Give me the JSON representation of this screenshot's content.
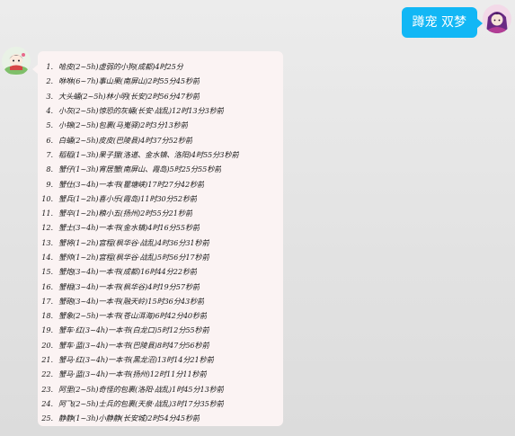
{
  "outgoing": {
    "sender_name": "蹲宠 双梦"
  },
  "incoming": {
    "items": [
      {
        "num": "1.",
        "text": "哈皮(2~5h)虚弱的小狗(成都)4时25分"
      },
      {
        "num": "2.",
        "text": "咻咻(6~7h)事山果(南屏山)2时55分45秒前"
      },
      {
        "num": "3.",
        "text": "大头蛹(2~5h)林小明(长安)2时56分47秒前"
      },
      {
        "num": "4.",
        "text": "小灰(2~5h)惊恐的灰蛹(长安·战乱)12时13分3秒前"
      },
      {
        "num": "5.",
        "text": "小锦(2~5h)包裹(马嵬驿)2时3分13秒前"
      },
      {
        "num": "6.",
        "text": "白蛹(2~5h)皮皮(巴陵县)4时37分52秒前"
      },
      {
        "num": "7.",
        "text": "稻稻(1~3h)果子狸(洛道、金水镇、洛阳)4时55分3秒前"
      },
      {
        "num": "8.",
        "text": "蟹仔(1~3h)宵居蟹(南屏山、霞岛)5时25分55秒前"
      },
      {
        "num": "9.",
        "text": "蟹仕(3~4h)一本书(瞿塘峡)17时27分42秒前"
      },
      {
        "num": "10.",
        "text": "蟹兵(1~2h)喜小乐(霞岛)11时30分52秒前"
      },
      {
        "num": "11.",
        "text": "蟹卒(1~2h)粮小五(扬州)2时55分21秒前"
      },
      {
        "num": "12.",
        "text": "蟹士(3~4h)一本书(金水镇)4时16分55秒前"
      },
      {
        "num": "13.",
        "text": "蟹将(1~2h)宫程(枫华谷·战乱)4时36分31秒前"
      },
      {
        "num": "14.",
        "text": "蟹帅(1~2h)宫程(枫华谷·战乱)5时56分17秒前"
      },
      {
        "num": "15.",
        "text": "蟹炮(3~4h)一本书(成都)16时44分22秒前"
      },
      {
        "num": "16.",
        "text": "蟹相(3~4h)一本书(枫华谷)4时19分57秒前"
      },
      {
        "num": "17.",
        "text": "蟹砲(3~4h)一本书(融天岭)15时36分43秒前"
      },
      {
        "num": "18.",
        "text": "蟹象(2~5h)一本书(苍山洱海)6时42分40秒前"
      },
      {
        "num": "19.",
        "text": "蟹车·红(3~4h)一本书(白龙口)5时12分55秒前"
      },
      {
        "num": "20.",
        "text": "蟹车·蓝(3~4h)一本书(巴陵县)8时47分56秒前"
      },
      {
        "num": "21.",
        "text": "蟹马·红(3~4h)一本书(黑龙沼)13时14分21秒前"
      },
      {
        "num": "22.",
        "text": "蟹马·蓝(3~4h)一本书(扬州)12时11分11秒前"
      },
      {
        "num": "23.",
        "text": "阿里(2~5h)奇怪的包裹(洛阳·战乱)1时45分13秒前"
      },
      {
        "num": "24.",
        "text": "阿飞(2~5h)士兵的包裹(天泉·战乱)3时17分35秒前"
      },
      {
        "num": "25.",
        "text": "静静(1~3h)小静静(长安城)2时54分45秒前"
      }
    ]
  },
  "colors": {
    "outgoing_bubble": "#12b7f5",
    "incoming_bubble": "#fbf3f3",
    "background": "#e3e3e3"
  }
}
